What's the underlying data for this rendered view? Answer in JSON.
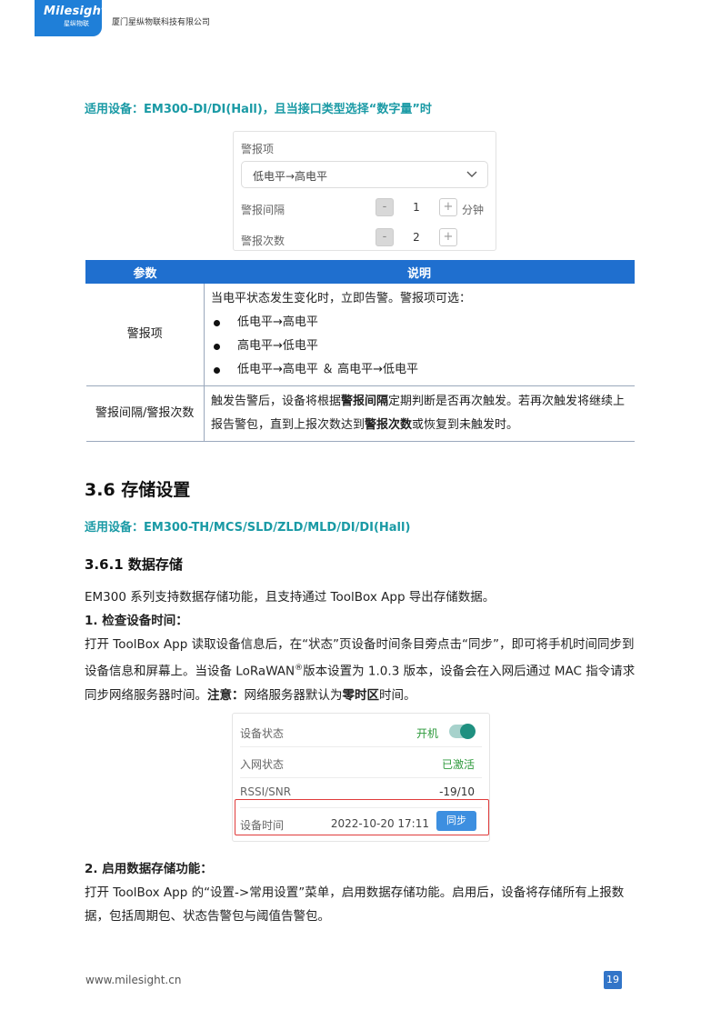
{
  "header": {
    "logo_name": "Milesight",
    "logo_sub": "星纵物联",
    "company": "厦门星纵物联科技有限公司"
  },
  "section1": {
    "applicable": "适用设备：EM300-DI/DI(Hall)，且当接口类型选择“数字量”时"
  },
  "alarm_panel": {
    "alarm_item_label": "警报项",
    "alarm_item_value": "低电平→高电平",
    "interval_label": "警报间隔",
    "interval_value": "1",
    "interval_unit": "分钟",
    "count_label": "警报次数",
    "count_value": "2",
    "minus_symbol": "-",
    "plus_symbol": "+"
  },
  "table": {
    "headers": [
      "参数",
      "说明"
    ],
    "row1": {
      "param": "警报项",
      "intro": "当电平状态发生变化时，立即告警。警报项可选：",
      "options": [
        "低电平→高电平",
        "高电平→低电平",
        "低电平→高电平 ＆ 高电平→低电平"
      ]
    },
    "row2": {
      "param": "警报间隔/警报次数",
      "desc_a": "触发告警后，设备将根据",
      "desc_b": "警报间隔",
      "desc_c": "定期判断是否再次触发。若再次触发将继续上报告警包，直到上报次数达到",
      "desc_d": "警报次数",
      "desc_e": "或恢复到未触发时。"
    }
  },
  "section2": {
    "heading": "3.6  存储设置",
    "applicable": "适用设备：EM300-TH/MCS/SLD/ZLD/MLD/DI/DI(Hall)",
    "sub_heading": "3.6.1 数据存储",
    "intro": "EM300 系列支持数据存储功能，且支持通过 ToolBox App 导出存储数据。",
    "step1_title": "1. 检查设备时间：",
    "step1_a": "打开 ToolBox App 读取设备信息后，在“状态”页设备时间条目旁点击“同步”，即可将手机时间同步到设备信息和屏幕上。当设备 LoRaWAN",
    "step1_reg": "®",
    "step1_b": "版本设置为 1.0.3 版本，设备会在入网后通过 MAC 指令请求同步网络服务器时间。",
    "step1_note": "注意：",
    "step1_c": "网络服务器默认为",
    "step1_zone": "零时区",
    "step1_d": "时间。",
    "step2_title": "2. 启用数据存储功能：",
    "step2_text": "打开 ToolBox App 的“设置->常用设置”菜单，启用数据存储功能。启用后，设备将存储所有上报数据，包括周期包、状态告警包与阈值告警包。"
  },
  "status_card": {
    "device_status_label": "设备状态",
    "device_status_value": "开机",
    "network_label": "入网状态",
    "network_value": "已激活",
    "rssi_label": "RSSI/SNR",
    "rssi_value": "-19/10",
    "time_label": "设备时间",
    "time_value": "2022-10-20 17:11",
    "sync_button": "同步",
    "colors": {
      "active_green": "#2e9a3c",
      "toggle": "#1f9080",
      "highlight": "#e03b3b"
    }
  },
  "footer": {
    "url": "www.milesight.cn",
    "page": "19"
  }
}
